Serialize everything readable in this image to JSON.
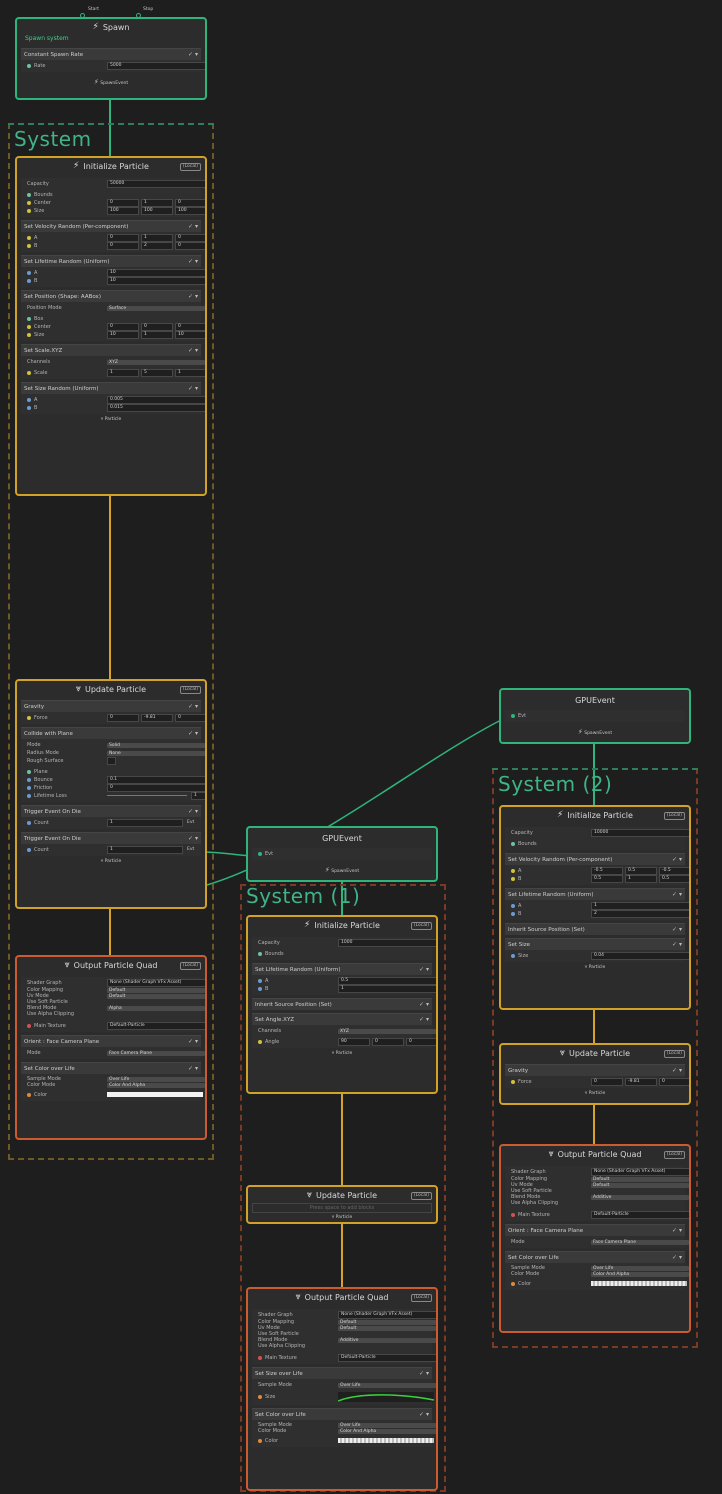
{
  "colors": {
    "spawn": "#2fb47c",
    "init": "#d1a227",
    "update": "#d1a227",
    "output": "#cc5b2f",
    "link": "#2fb47c",
    "flow": "#d7a22a"
  },
  "spawn": {
    "ports": [
      "Start",
      "Stop"
    ],
    "title": "Spawn",
    "subtitle": "Spawn system",
    "block": "Constant Spawn Rate",
    "rate_label": "Rate",
    "rate_value": "5000",
    "out": "SpawnEvent"
  },
  "system1": {
    "title": "System"
  },
  "init1": {
    "title": "Initialize Particle",
    "badge": "(Local)",
    "capacity_label": "Capacity",
    "capacity": "50000",
    "bounds": "Bounds",
    "center": "Center",
    "size": "Size",
    "center_vals": [
      "0",
      "1",
      "0"
    ],
    "size_vals": [
      "100",
      "100",
      "100"
    ],
    "vel_block": "Set Velocity Random (Per-component)",
    "vel_a": [
      "0",
      "1",
      "0"
    ],
    "vel_b": [
      "0",
      "2",
      "0"
    ],
    "life_block": "Set Lifetime Random (Uniform)",
    "life_a": "10",
    "life_b": "10",
    "pos_block": "Set Position (Shape: AABox)",
    "pos_mode_label": "Position Mode",
    "pos_mode": "Surface",
    "box": "Box",
    "box_center": [
      "0",
      "0",
      "0"
    ],
    "box_size": [
      "10",
      "1",
      "10"
    ],
    "scale_block": "Set Scale.XYZ",
    "channels_label": "Channels",
    "channels": "XYZ",
    "scale_label": "Scale",
    "scale_vals": [
      "1",
      "5",
      "1"
    ],
    "sizer_block": "Set Size Random (Uniform)",
    "size_a": "0.005",
    "size_b": "0.015",
    "out": "Particle"
  },
  "update1": {
    "title": "Update Particle",
    "badge": "(Local)",
    "gravity": "Gravity",
    "force_label": "Force",
    "force": [
      "0",
      "-9.81",
      "0"
    ],
    "collide": "Collide with Plane",
    "mode_label": "Mode",
    "mode": "Solid",
    "radius_label": "Radius Mode",
    "radius": "None",
    "rough": "Rough Surface",
    "plane": "Plane",
    "bounce_label": "Bounce",
    "bounce": "0.1",
    "friction_label": "Friction",
    "friction": "0",
    "lifetime_loss_label": "Lifetime Loss",
    "lifetime_loss": "1",
    "trigger1": "Trigger Event On Die",
    "trigger2": "Trigger Event On Die",
    "count_label": "Count",
    "count1": "1",
    "count2": "1",
    "evt": "Evt",
    "out": "Particle"
  },
  "output1": {
    "title": "Output Particle Quad",
    "badge": "(Local)",
    "rows": [
      "Shader Graph",
      "Color Mapping",
      "Uv Mode",
      "Use Soft Particle",
      "Blend Mode",
      "Use Alpha Clipping"
    ],
    "shader": "None (Shader Graph VFx Asset)",
    "color_mapping": "Default",
    "uv_mode": "Default",
    "blend": "Alpha",
    "main_tex_label": "Main Texture",
    "main_tex": "Default-Particle",
    "orient": "Orient : Face Camera Plane",
    "orient_mode_label": "Mode",
    "orient_mode": "Face Camera Plane",
    "col_block": "Set Color over Life",
    "sample_label": "Sample Mode",
    "sample": "Over Life",
    "colmode_label": "Color Mode",
    "colmode": "Color And Alpha",
    "color_label": "Color"
  },
  "gpu1": {
    "title": "GPUEvent",
    "evt": "Evt",
    "out": "SpawnEvent"
  },
  "gpu2": {
    "title": "GPUEvent",
    "evt": "Evt",
    "out": "SpawnEvent"
  },
  "system2": {
    "title": "System (1)"
  },
  "system3": {
    "title": "System (2)"
  },
  "init2": {
    "title": "Initialize Particle",
    "badge": "(Local)",
    "capacity_label": "Capacity",
    "capacity": "1000",
    "bounds": "Bounds",
    "life_block": "Set Lifetime Random (Uniform)",
    "life_a": "0.5",
    "life_b": "1",
    "inherit": "Inherit Source Position (Set)",
    "angle_block": "Set Angle.XYZ",
    "channels_label": "Channels",
    "channels": "XYZ",
    "angle_label": "Angle",
    "angle": [
      "90",
      "0",
      "0"
    ],
    "out": "Particle"
  },
  "update2": {
    "title": "Update Particle",
    "badge": "(Local)",
    "placeholder": "Press space to add blocks",
    "out": "Particle"
  },
  "output2": {
    "title": "Output Particle Quad",
    "badge": "(Local)",
    "rows": [
      "Shader Graph",
      "Color Mapping",
      "Uv Mode",
      "Use Soft Particle",
      "Blend Mode",
      "Use Alpha Clipping"
    ],
    "shader": "None (Shader Graph VFx Asset)",
    "color_mapping": "Default",
    "uv_mode": "Default",
    "blend": "Additive",
    "main_tex_label": "Main Texture",
    "main_tex": "Default-Particle",
    "size_block": "Set Size over Life",
    "sample_label": "Sample Mode",
    "sample": "Over Life",
    "size_label": "Size",
    "col_block": "Set Color over Life",
    "colmode_label": "Color Mode",
    "colmode": "Color And Alpha",
    "color_label": "Color"
  },
  "init3": {
    "title": "Initialize Particle",
    "badge": "(Local)",
    "capacity_label": "Capacity",
    "capacity": "10000",
    "bounds": "Bounds",
    "vel_block": "Set Velocity Random (Per-component)",
    "vel_a": [
      "-0.5",
      "0.5",
      "-0.5"
    ],
    "vel_b": [
      "0.5",
      "1",
      "0.5"
    ],
    "life_block": "Set Lifetime Random (Uniform)",
    "life_a": "1",
    "life_b": "2",
    "inherit": "Inherit Source Position (Set)",
    "size_block": "Set Size",
    "size_label": "Size",
    "size": "0.04",
    "out": "Particle"
  },
  "update3": {
    "title": "Update Particle",
    "badge": "(Local)",
    "gravity": "Gravity",
    "force_label": "Force",
    "force": [
      "0",
      "-9.81",
      "0"
    ],
    "out": "Particle"
  },
  "output3": {
    "title": "Output Particle Quad",
    "badge": "(Local)",
    "rows": [
      "Shader Graph",
      "Color Mapping",
      "Uv Mode",
      "Use Soft Particle",
      "Blend Mode",
      "Use Alpha Clipping"
    ],
    "shader": "None (Shader Graph VFx Asset)",
    "color_mapping": "Default",
    "uv_mode": "Default",
    "blend": "Additive",
    "main_tex_label": "Main Texture",
    "main_tex": "Default-Particle",
    "orient": "Orient : Face Camera Plane",
    "orient_mode_label": "Mode",
    "orient_mode": "Face Camera Plane",
    "col_block": "Set Color over Life",
    "sample_label": "Sample Mode",
    "sample": "Over Life",
    "colmode_label": "Color Mode",
    "colmode": "Color And Alpha",
    "color_label": "Color"
  }
}
